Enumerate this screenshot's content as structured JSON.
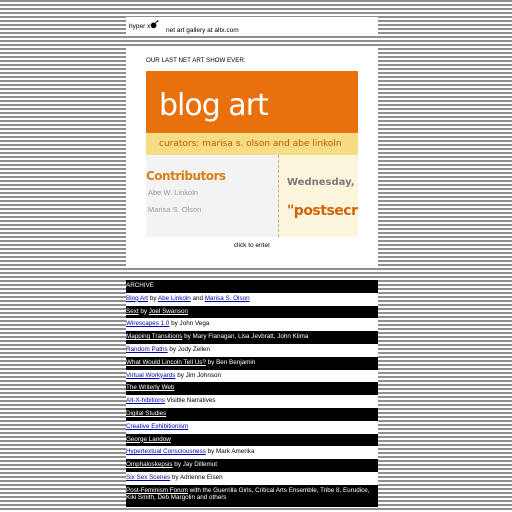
{
  "header": {
    "logo_text": "hyper x",
    "tagline": "net art gallery at altx.com"
  },
  "main": {
    "show_label": "OUR LAST NET ART SHOW EVER:",
    "banner": {
      "title": "blog art",
      "curators": "curators: marisa s. olson and abe linkoln",
      "contributors_heading": "Contributors",
      "contributor_1": "Abe W. Linkoln",
      "contributor_2": "Marisa S. Olson",
      "date_text": "Wednesday, Augu",
      "post_text": "\"postsecret"
    },
    "enter_link": "click to enter"
  },
  "archive": {
    "heading": "ARCHIVE",
    "items": [
      {
        "link": "Blog Art",
        "mid1": " by ",
        "link2": "Abe Linkoln",
        "mid2": " and ",
        "link3": "Marisa S. Olson",
        "rest": ""
      },
      {
        "link": "Sext",
        "mid1": " by ",
        "link2": "Joel Swanson",
        "mid2": "",
        "link3": "",
        "rest": ""
      },
      {
        "link": "Wirescapes 1.0",
        "mid1": "",
        "link2": "",
        "mid2": "",
        "link3": "",
        "rest": " by John Vega"
      },
      {
        "link": "Mapping Transitions",
        "mid1": "",
        "link2": "",
        "mid2": "",
        "link3": "",
        "rest": " by Mary Flanagan, Lisa Jevbratt, John Klima"
      },
      {
        "link": "Random Paths",
        "mid1": "",
        "link2": "",
        "mid2": "",
        "link3": "",
        "rest": " by Jody Zellen"
      },
      {
        "link": "What Would Lincoln Tell Us?",
        "mid1": "",
        "link2": "",
        "mid2": "",
        "link3": "",
        "rest": " by Ben Benjamin"
      },
      {
        "link": "Virtual Workyards",
        "mid1": "",
        "link2": "",
        "mid2": "",
        "link3": "",
        "rest": " by Jim Johnson"
      },
      {
        "link": "The Writerly Web",
        "mid1": "",
        "link2": "",
        "mid2": "",
        "link3": "",
        "rest": ""
      },
      {
        "link": "Alt-X-hibitions",
        "mid1": "",
        "link2": "",
        "mid2": "",
        "link3": "",
        "rest": " Visible Narratives"
      },
      {
        "link": "Digital Studies",
        "mid1": "",
        "link2": "",
        "mid2": "",
        "link3": "",
        "rest": ""
      },
      {
        "link": "Creative Exhibitionism",
        "mid1": "",
        "link2": "",
        "mid2": "",
        "link3": "",
        "rest": ""
      },
      {
        "link": "George Landow",
        "mid1": "",
        "link2": "",
        "mid2": "",
        "link3": "",
        "rest": ""
      },
      {
        "link": "Hypertextual Consciousness",
        "mid1": "",
        "link2": "",
        "mid2": "",
        "link3": "",
        "rest": " by Mark Amerika"
      },
      {
        "link": "Omphaloskepsis",
        "mid1": "",
        "link2": "",
        "mid2": "",
        "link3": "",
        "rest": " by Jay Dillemut"
      },
      {
        "link": "Six Sex Scenes",
        "mid1": "",
        "link2": "",
        "mid2": "",
        "link3": "",
        "rest": " by Adrienne Eisen"
      },
      {
        "link": "Post-Feminism Forum",
        "mid1": "",
        "link2": "",
        "mid2": "",
        "link3": "",
        "rest": " with the Guerrilla Girls, Critical Arts Ensemble, Tribe 8, Eurudice, Kiki Smith, Deb Margolin and others"
      }
    ]
  }
}
